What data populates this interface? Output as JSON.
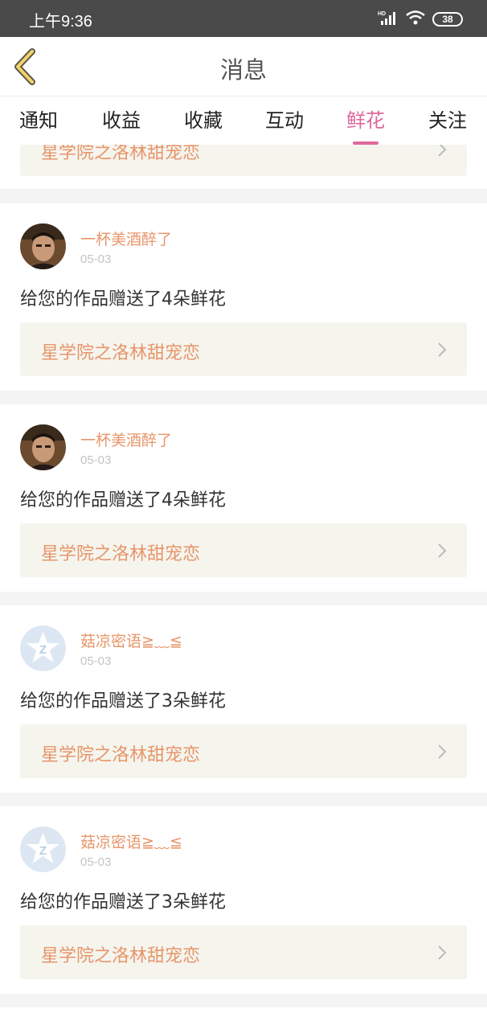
{
  "status": {
    "time": "上午9:36",
    "battery": "38",
    "network": "HD"
  },
  "header": {
    "title": "消息"
  },
  "tabs": [
    {
      "label": "通知"
    },
    {
      "label": "收益"
    },
    {
      "label": "收藏"
    },
    {
      "label": "互动"
    },
    {
      "label": "鲜花"
    },
    {
      "label": "关注"
    }
  ],
  "active_tab": "鲜花",
  "partial_top_card": {
    "work_title": "星学院之洛林甜宠恋"
  },
  "messages": [
    {
      "user": "一杯美酒醉了",
      "date": "05-03",
      "text": "给您的作品赠送了4朵鲜花",
      "work_title": "星学院之洛林甜宠恋",
      "avatar": "photo-avatar"
    },
    {
      "user": "一杯美酒醉了",
      "date": "05-03",
      "text": "给您的作品赠送了4朵鲜花",
      "work_title": "星学院之洛林甜宠恋",
      "avatar": "photo-avatar"
    },
    {
      "user": "菇凉密语≧﹏≦",
      "date": "05-03",
      "text": "给您的作品赠送了3朵鲜花",
      "work_title": "星学院之洛林甜宠恋",
      "avatar": "default-star-avatar"
    },
    {
      "user": "菇凉密语≧﹏≦",
      "date": "05-03",
      "text": "给您的作品赠送了3朵鲜花",
      "work_title": "星学院之洛林甜宠恋",
      "avatar": "default-star-avatar"
    }
  ],
  "colors": {
    "accent": "#e0679c",
    "username": "#e8956a",
    "work_bg": "#f5f5ee"
  }
}
